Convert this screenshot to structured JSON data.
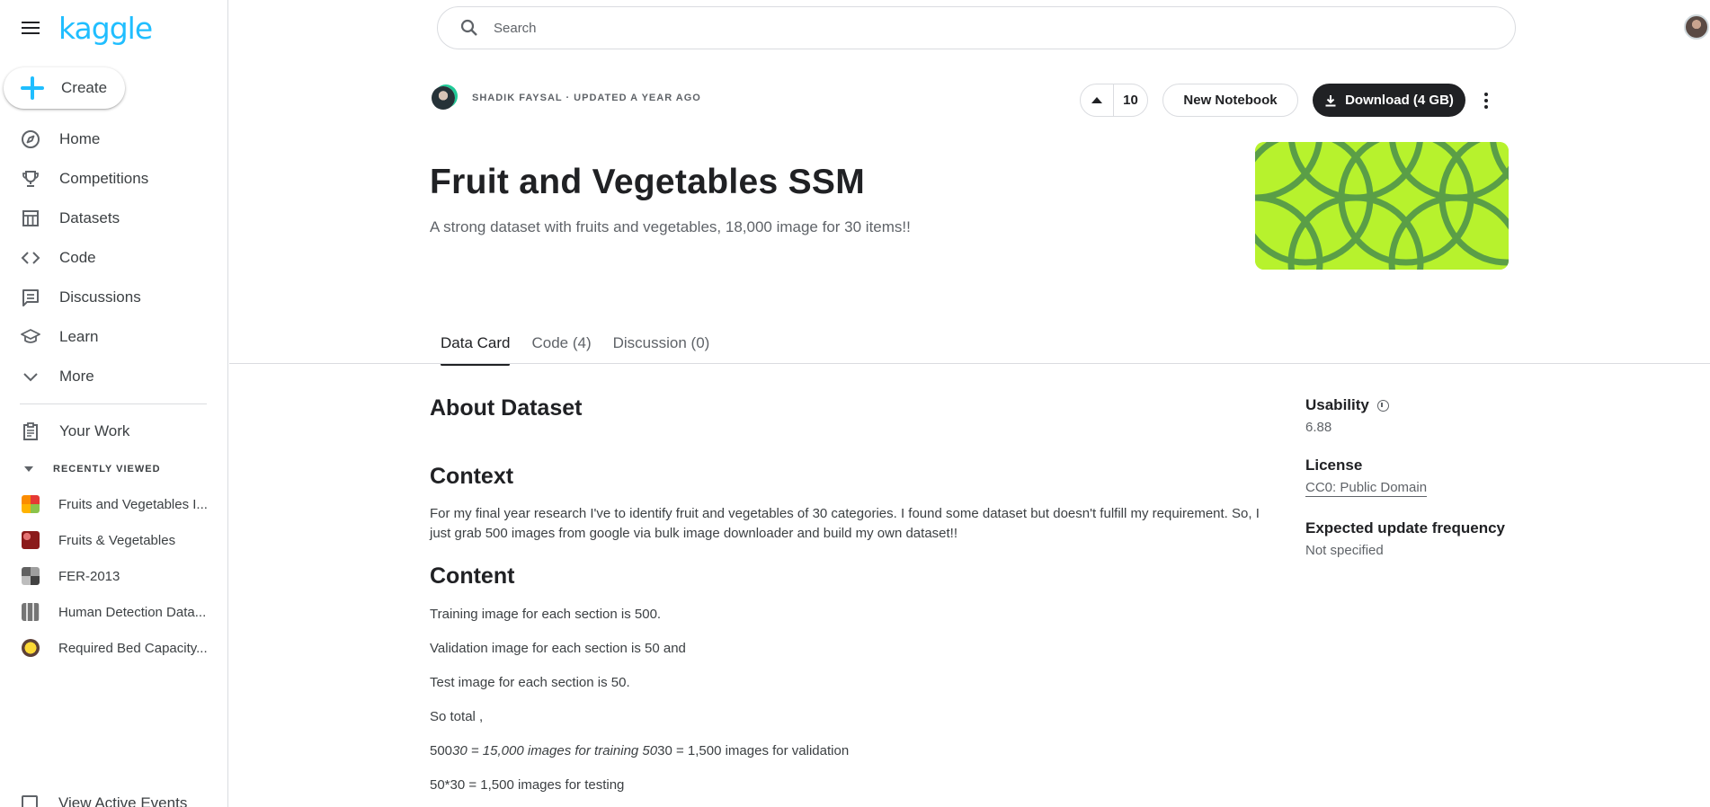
{
  "app": {
    "logo_text": "kaggle",
    "accent_color": "#20beff"
  },
  "sidebar": {
    "create_label": "Create",
    "nav": [
      {
        "label": "Home",
        "icon": "compass-icon"
      },
      {
        "label": "Competitions",
        "icon": "trophy-icon"
      },
      {
        "label": "Datasets",
        "icon": "table-icon"
      },
      {
        "label": "Code",
        "icon": "code-brackets-icon"
      },
      {
        "label": "Discussions",
        "icon": "comment-icon"
      },
      {
        "label": "Learn",
        "icon": "graduation-cap-icon"
      },
      {
        "label": "More",
        "icon": "chevron-down-icon"
      }
    ],
    "your_work_label": "Your Work",
    "recently_viewed_label": "RECENTLY VIEWED",
    "recent_items": [
      {
        "label": "Fruits and Vegetables I..."
      },
      {
        "label": "Fruits & Vegetables"
      },
      {
        "label": "FER-2013"
      },
      {
        "label": "Human Detection Data..."
      },
      {
        "label": "Required Bed Capacity..."
      }
    ],
    "view_events_label": "View Active Events"
  },
  "search": {
    "placeholder": "Search"
  },
  "dataset": {
    "owner_line": "SHADIK FAYSAL · UPDATED A YEAR AGO",
    "vote_count": "10",
    "new_notebook_label": "New Notebook",
    "download_label": "Download (4 GB)",
    "title": "Fruit and Vegetables SSM",
    "subtitle": "A strong dataset with fruits and vegetables, 18,000 image for 30 items!!",
    "cover_color": "#b7f22d"
  },
  "tabs": [
    {
      "label": "Data Card",
      "active": true
    },
    {
      "label": "Code (4)",
      "active": false
    },
    {
      "label": "Discussion (0)",
      "active": false
    }
  ],
  "content": {
    "about_heading": "About Dataset",
    "context_heading": "Context",
    "context_text": "For my final year research I've to identify fruit and vegetables of 30 categories. I found some dataset but doesn't fulfill my requirement. So, I just grab 500 images from google via bulk image downloader and build my own dataset!!",
    "content_heading": "Content",
    "line1": "Training image for each section is 500.",
    "line2": "Validation image for each section is 50 and",
    "line3": "Test image for each section is 50.",
    "line4": "So total ,",
    "line5_a": "500",
    "line5_b": "30 = 15,000 images for training 50",
    "line5_c": "30 = 1,500 images for validation",
    "line6": "50*30 = 1,500 images for testing"
  },
  "meta": {
    "usability_label": "Usability",
    "usability_value": "6.88",
    "license_label": "License",
    "license_value": "CC0: Public Domain",
    "frequency_label": "Expected update frequency",
    "frequency_value": "Not specified"
  }
}
